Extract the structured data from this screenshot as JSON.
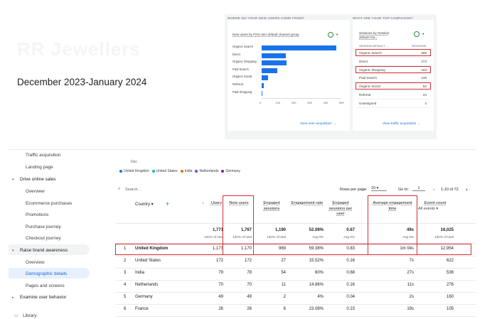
{
  "slide": {
    "brand": "RR Jewellers",
    "date_range": "December 2023-January 2024"
  },
  "acquisition_card": {
    "section_title": "WHERE DO YOUR NEW USERS COME FROM?",
    "metric_label": "New users by First user default channel group",
    "link": "View user acquisition",
    "chart_data": {
      "type": "bar",
      "orientation": "horizontal",
      "categories": [
        "Organic Search",
        "Direct",
        "Organic Shopping",
        "Paid Search",
        "Organic Social",
        "Referral",
        "Paid Shopping"
      ],
      "values": [
        468,
        150,
        155,
        100,
        40,
        12,
        3
      ],
      "xticks": [
        "0",
        "100",
        "200",
        "300",
        "400",
        "500"
      ],
      "xlim": [
        0,
        500
      ]
    }
  },
  "campaign_card": {
    "section_title": "WHAT ARE YOUR TOP CAMPAIGNS?",
    "col1": "Sessions by Session default cha...",
    "col1_sub": "SESSION DEFAULT ...",
    "col2_sub": "SESSIONS",
    "rows": [
      {
        "name": "Organic Search",
        "value": "595"
      },
      {
        "name": "Direct",
        "value": "273"
      },
      {
        "name": "Organic Shopping",
        "value": "183"
      },
      {
        "name": "Paid Search",
        "value": "139"
      },
      {
        "name": "Organic Social",
        "value": "53"
      },
      {
        "name": "Referral",
        "value": "24"
      },
      {
        "name": "Unassigned",
        "value": "4"
      }
    ],
    "link": "View traffic acquisition"
  },
  "nav": {
    "items": [
      {
        "label": "Traffic acquisition",
        "level": "sub"
      },
      {
        "label": "Landing page",
        "level": "sub"
      },
      {
        "label": "Drive online sales",
        "level": "group"
      },
      {
        "label": "Overview",
        "level": "sub"
      },
      {
        "label": "Ecommerce purchases",
        "level": "sub"
      },
      {
        "label": "Promotions",
        "level": "sub"
      },
      {
        "label": "Purchase journey",
        "level": "sub"
      },
      {
        "label": "Checkout journey",
        "level": "sub"
      },
      {
        "label": "Raise brand awareness",
        "level": "group"
      },
      {
        "label": "Overview",
        "level": "sub"
      },
      {
        "label": "Demographic details",
        "level": "active"
      },
      {
        "label": "Pages and screens",
        "level": "sub"
      },
      {
        "label": "Examine user behavior",
        "level": "group"
      },
      {
        "label": "Library",
        "level": "footer"
      }
    ]
  },
  "table": {
    "axis_label": "Dec",
    "legend": [
      {
        "name": "United Kingdom",
        "color": "#1a73e8"
      },
      {
        "name": "United States",
        "color": "#12b5cb"
      },
      {
        "name": "India",
        "color": "#e8710a"
      },
      {
        "name": "Netherlands",
        "color": "#9334e6"
      },
      {
        "name": "Germany",
        "color": "#7b1fa2"
      }
    ],
    "search_placeholder": "Search...",
    "rows_per_page_label": "Rows per page:",
    "rows_per_page": "10",
    "goto_label": "Go to:",
    "goto_value": "1",
    "pagination": "1-10 of 72",
    "dimension_header": "Country",
    "headers": [
      "Users",
      "New users",
      "Engaged sessions",
      "Engagement rate",
      "Engaged sessions per user",
      "Average engagement time",
      "Event count"
    ],
    "event_dropdown": "All events",
    "totals": [
      "1,771",
      "1,767",
      "1,190",
      "52.08%",
      "0.67",
      "49s",
      "16,025"
    ],
    "totals_sub": [
      "100% of total",
      "100% of total",
      "100% of total",
      "Avg 0%",
      "Avg 0%",
      "Avg 0%",
      "100% of total"
    ],
    "rows": [
      {
        "n": "1",
        "country": "United Kingdom",
        "cells": [
          "1,173",
          "1,170",
          "969",
          "59.38%",
          "0.83",
          "1m 04s",
          "12,954"
        ]
      },
      {
        "n": "2",
        "country": "United States",
        "cells": [
          "172",
          "172",
          "27",
          "15.52%",
          "0.16",
          "7s",
          "622"
        ]
      },
      {
        "n": "3",
        "country": "India",
        "cells": [
          "79",
          "78",
          "54",
          "60%",
          "0.68",
          "27s",
          "536"
        ]
      },
      {
        "n": "4",
        "country": "Netherlands",
        "cells": [
          "70",
          "70",
          "11",
          "14.86%",
          "0.16",
          "11s",
          "276"
        ]
      },
      {
        "n": "5",
        "country": "Germany",
        "cells": [
          "49",
          "49",
          "2",
          "4%",
          "0.04",
          "2s",
          "160"
        ]
      },
      {
        "n": "6",
        "country": "France",
        "cells": [
          "26",
          "26",
          "6",
          "23.08%",
          "0.23",
          "19s",
          "105"
        ]
      }
    ]
  }
}
